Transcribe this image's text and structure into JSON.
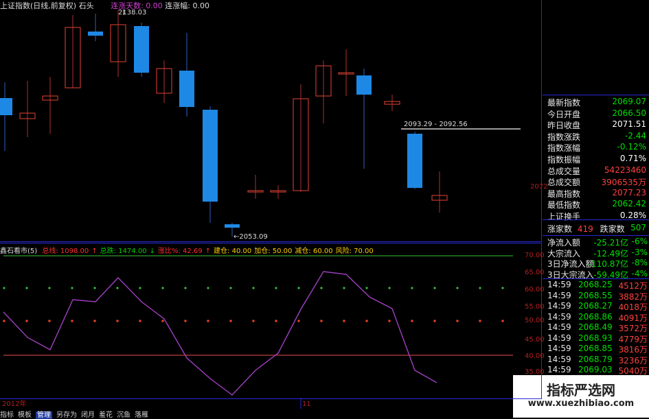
{
  "header": {
    "index_name": "上证指数(日线,前复权)",
    "formula": "石头",
    "streak_days_label": "连涨天数: 0.00",
    "streak_range_label": "连涨幅: 0.00"
  },
  "main_chart": {
    "high_label": "2138.03",
    "low_label": "←2053.09",
    "range_label": "2093.29 - 2092.56",
    "axis_label": "2072"
  },
  "oscillator": {
    "name": "鑫石看市(5)",
    "params": [
      {
        "label": "总线: 1098.00",
        "color": "#ff3030"
      },
      {
        "label": "↑",
        "color": "#ff3030"
      },
      {
        "label": "总跌: 1474.00",
        "color": "#00d000"
      },
      {
        "label": "↓",
        "color": "#00d000"
      },
      {
        "label": "涨比%: 42.69",
        "color": "#ff3030"
      },
      {
        "label": "↑",
        "color": "#ff3030"
      },
      {
        "label": "建仓: 40.00",
        "color": "#ffd000"
      },
      {
        "label": "加仓: 50.00",
        "color": "#ffd000"
      },
      {
        "label": "减仓: 60.00",
        "color": "#ffd000"
      },
      {
        "label": "风险: 70.00",
        "color": "#ffd000"
      }
    ],
    "y_labels": [
      "70.00",
      "65.00",
      "60.00",
      "55.00",
      "50.00",
      "45.00",
      "40.00",
      "35.00"
    ],
    "x_labels": [
      "2012年",
      "11"
    ]
  },
  "quote_panel": [
    {
      "label": "最新指数",
      "value": "2069.07",
      "color": "#00e000"
    },
    {
      "label": "今日开盘",
      "value": "2066.50",
      "color": "#00e000"
    },
    {
      "label": "昨日收盘",
      "value": "2071.51",
      "color": "#ffffff"
    },
    {
      "label": "指数涨跌",
      "value": "-2.44",
      "color": "#00e000"
    },
    {
      "label": "指数涨幅",
      "value": "-0.12%",
      "color": "#00e000"
    },
    {
      "label": "指数振幅",
      "value": "0.71%",
      "color": "#ffffff"
    },
    {
      "label": "总成交量",
      "value": "54223460",
      "color": "#ff4040"
    },
    {
      "label": "总成交额",
      "value": "3906535万",
      "color": "#ff4040"
    },
    {
      "label": "最高指数",
      "value": "2077.23",
      "color": "#ff4040"
    },
    {
      "label": "最低指数",
      "value": "2062.42",
      "color": "#00e000"
    },
    {
      "label": "上证换手",
      "value": "0.28%",
      "color": "#ffffff"
    }
  ],
  "breadth": {
    "up_label": "涨家数",
    "up_value": "419",
    "down_label": "跌家数",
    "down_value": "507"
  },
  "flows": [
    {
      "label": "净流入额",
      "value": "-25.21亿",
      "pct": "-6%"
    },
    {
      "label": "大宗流入",
      "value": "-12.49亿",
      "pct": "-3%"
    },
    {
      "label": "3日净流入额",
      "value": "-110.87亿",
      "pct": "-8%"
    },
    {
      "label": "3日大宗流入",
      "value": "-59.49亿",
      "pct": "-4%"
    }
  ],
  "ticks": [
    {
      "time": "14:59",
      "price": "2068.25",
      "vol": "4512万"
    },
    {
      "time": "14:59",
      "price": "2068.55",
      "vol": "3882万"
    },
    {
      "time": "14:59",
      "price": "2068.27",
      "vol": "4018万"
    },
    {
      "time": "14:59",
      "price": "2068.86",
      "vol": "4091万"
    },
    {
      "time": "14:59",
      "price": "2068.49",
      "vol": "3572万"
    },
    {
      "time": "14:59",
      "price": "2068.93",
      "vol": "4779万"
    },
    {
      "time": "14:59",
      "price": "2068.85",
      "vol": "3816万"
    },
    {
      "time": "14:59",
      "price": "2068.79",
      "vol": "3236万"
    },
    {
      "time": "14:59",
      "price": "2069.03",
      "vol": "5040万"
    }
  ],
  "tabs": [
    "指标",
    "模板",
    "管理",
    "另存为",
    "闭月",
    "羞花",
    "沉鱼",
    "落雁"
  ],
  "active_tab": 2,
  "watermark": {
    "title": "指标严选网",
    "url": "www.xuezhibiao.com"
  },
  "colors": {
    "up": "#c0392b",
    "down": "#1e88e5",
    "osc_line": "#a040c0"
  }
}
